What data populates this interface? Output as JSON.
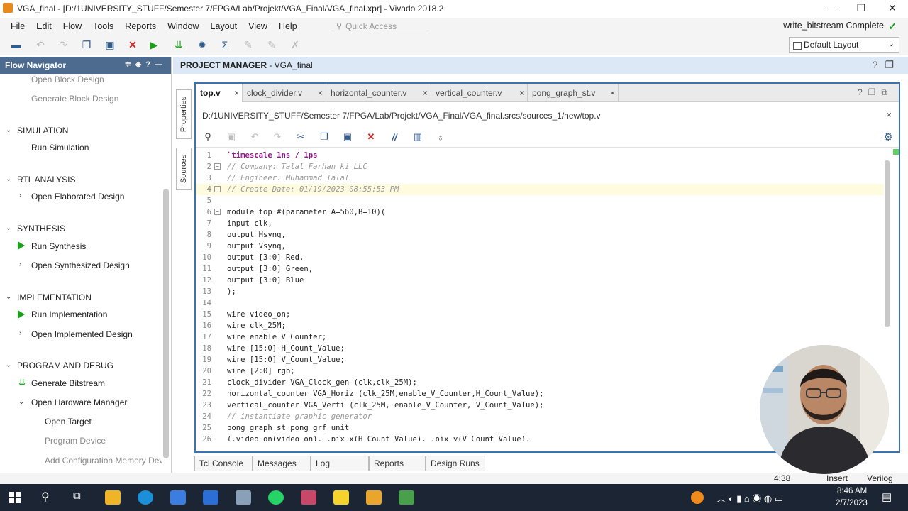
{
  "window": {
    "title": "VGA_final - [D:/1UNIVERSITY_STUFF/Semester 7/FPGA/Lab/Projekt/VGA_Final/VGA_final.xpr] - Vivado 2018.2",
    "minimize": "—",
    "restore": "❐",
    "close": "✕"
  },
  "menu": {
    "items": [
      "File",
      "Edit",
      "Flow",
      "Tools",
      "Reports",
      "Window",
      "Layout",
      "View",
      "Help"
    ],
    "quick_access_placeholder": "Quick Access",
    "status": "write_bitstream Complete"
  },
  "toolbar": {
    "layout_select": "Default Layout"
  },
  "flow_navigator": {
    "title": "Flow Navigator",
    "block_items": [
      "Open Block Design",
      "Generate Block Design"
    ],
    "sections": [
      {
        "title": "SIMULATION",
        "items": [
          "Run Simulation"
        ]
      },
      {
        "title": "RTL ANALYSIS",
        "items": [
          "Open Elaborated Design"
        ]
      },
      {
        "title": "SYNTHESIS",
        "items": [
          "Run Synthesis",
          "Open Synthesized Design"
        ]
      },
      {
        "title": "IMPLEMENTATION",
        "items": [
          "Run Implementation",
          "Open Implemented Design"
        ]
      },
      {
        "title": "PROGRAM AND DEBUG",
        "items": [
          "Generate Bitstream",
          "Open Hardware Manager",
          "Open Target",
          "Program Device",
          "Add Configuration Memory Devic"
        ]
      }
    ]
  },
  "project_manager": {
    "title_bold": "PROJECT MANAGER",
    "title_rest": " - VGA_final",
    "side_tabs": [
      "Properties",
      "Sources"
    ]
  },
  "editor": {
    "tabs": [
      "top.v",
      "clock_divider.v",
      "horizontal_counter.v",
      "vertical_counter.v",
      "pong_graph_st.v"
    ],
    "file_path": "D:/1UNIVERSITY_STUFF/Semester 7/FPGA/Lab/Projekt/VGA_Final/VGA_final.srcs/sources_1/new/top.v",
    "lines": [
      {
        "n": "1",
        "text": "`timescale 1ns / 1ps"
      },
      {
        "n": "2",
        "text": "// Company: Talal Farhan ki LLC"
      },
      {
        "n": "3",
        "text": "// Engineer: Muhammad Talal"
      },
      {
        "n": "4",
        "text": "// Create Date: 01/19/2023 08:55:53 PM"
      },
      {
        "n": "5",
        "text": ""
      },
      {
        "n": "6",
        "text": "module top #(parameter A=560,B=10)("
      },
      {
        "n": "7",
        "text": "input clk,"
      },
      {
        "n": "8",
        "text": "output Hsynq,"
      },
      {
        "n": "9",
        "text": "output Vsynq,"
      },
      {
        "n": "10",
        "text": "output [3:0] Red,"
      },
      {
        "n": "11",
        "text": "output [3:0] Green,"
      },
      {
        "n": "12",
        "text": "output [3:0] Blue"
      },
      {
        "n": "13",
        "text": ");"
      },
      {
        "n": "14",
        "text": ""
      },
      {
        "n": "15",
        "text": "wire video_on;"
      },
      {
        "n": "16",
        "text": "wire clk_25M;"
      },
      {
        "n": "17",
        "text": "wire enable_V_Counter;"
      },
      {
        "n": "18",
        "text": "wire [15:0] H_Count_Value;"
      },
      {
        "n": "19",
        "text": "wire [15:0] V_Count_Value;"
      },
      {
        "n": "20",
        "text": "wire [2:0] rgb;"
      },
      {
        "n": "21",
        "text": "clock_divider VGA_Clock_gen (clk,clk_25M);"
      },
      {
        "n": "22",
        "text": "horizontal_counter VGA_Horiz (clk_25M,enable_V_Counter,H_Count_Value);"
      },
      {
        "n": "23",
        "text": "vertical_counter VGA_Verti (clk_25M, enable_V_Counter, V_Count_Value);"
      },
      {
        "n": "24",
        "text": "// instantiate graphic generator"
      },
      {
        "n": "25",
        "text": "pong_graph_st pong_grf_unit"
      },
      {
        "n": "26",
        "text": "(.video_on(video_on), .pix_x(H_Count_Value), .pix_y(V_Count_Value),"
      }
    ]
  },
  "bottom_tabs": [
    "Tcl Console",
    "Messages",
    "Log",
    "Reports",
    "Design Runs"
  ],
  "status_bar": {
    "position": "4:38",
    "mode": "Insert",
    "language": "Verilog"
  },
  "taskbar": {
    "time": "8:46 AM",
    "date": "2/7/2023"
  }
}
